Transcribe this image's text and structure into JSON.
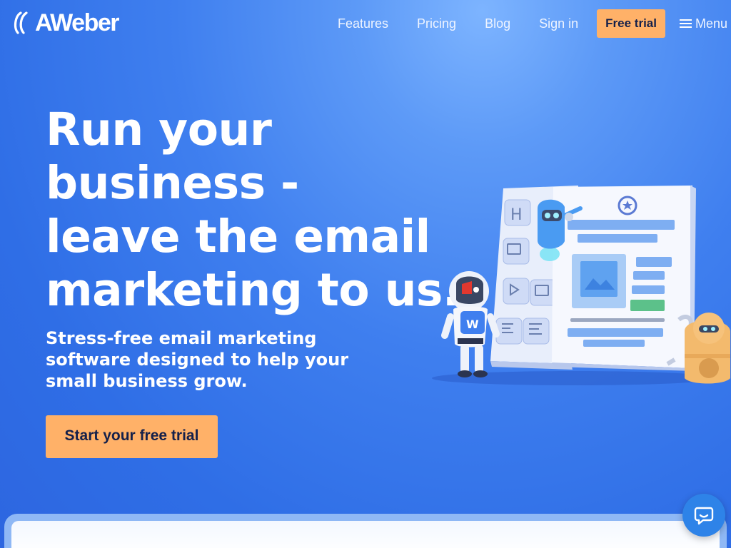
{
  "header": {
    "logo_text": "AWeber",
    "nav": {
      "features": "Features",
      "pricing": "Pricing",
      "blog": "Blog",
      "sign_in": "Sign in",
      "free_trial": "Free trial",
      "menu": "Menu"
    }
  },
  "hero": {
    "title_lines": [
      "Run your",
      "business -",
      "leave the email",
      "marketing to us."
    ],
    "subtitle": "Stress-free email marketing software designed to help your small business grow.",
    "cta": "Start your free trial"
  },
  "illustration": {
    "heading_tile": "H"
  },
  "colors": {
    "background": "#3f7fef",
    "cta": "#ffb168",
    "cta_text": "#14204a",
    "chat": "#2e83e8"
  },
  "icons": [
    "aweber-logo-icon",
    "hamburger-icon",
    "chat-icon"
  ]
}
